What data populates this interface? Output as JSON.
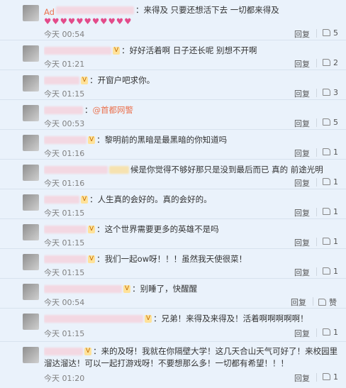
{
  "comments": [
    {
      "name": "Ad",
      "badge": "",
      "text": "：来得及 只要还想活下去 一切都来得及",
      "hearts": "♥♥♥♥♥♥♥♥♥♥♥",
      "time": "今天 00:54",
      "reply": "回复",
      "likes": "5"
    },
    {
      "name": "",
      "badge": "V",
      "text": "：好好活着啊 日子还长呢 别想不开啊",
      "time": "今天 01:21",
      "reply": "回复",
      "likes": "2"
    },
    {
      "name": "",
      "badge": "V",
      "text": "：开窗户吧求你。",
      "time": "今天 01:15",
      "reply": "回复",
      "likes": "3"
    },
    {
      "name": "",
      "badge": "",
      "text": "：",
      "mention": "@首都网警",
      "time": "今天 00:53",
      "reply": "回复",
      "likes": "5"
    },
    {
      "name": "",
      "badge": "V",
      "text": "：黎明前的黑暗是最黑暗的你知道吗",
      "time": "今天 01:16",
      "reply": "回复",
      "likes": "1"
    },
    {
      "name": "",
      "badge": "",
      "text": "候是你觉得不够好那只是没到最后而已 真的 前途光明",
      "time": "今天 01:16",
      "reply": "回复",
      "likes": "1"
    },
    {
      "name": "",
      "badge": "V",
      "text": "：人生真的会好的。真的会好的。",
      "time": "今天 01:15",
      "reply": "回复",
      "likes": "1"
    },
    {
      "name": "",
      "badge": "V",
      "text": "：这个世界需要更多的英雄不是吗",
      "time": "今天 01:15",
      "reply": "回复",
      "likes": "1"
    },
    {
      "name": "",
      "badge": "V",
      "text": "：我们一起ow呀！！！虽然我天使很菜！",
      "time": "今天 01:15",
      "reply": "回复",
      "likes": "1"
    },
    {
      "name": "",
      "badge": "V",
      "text": "：别睡了，快醒醒",
      "time": "今天 00:54",
      "reply": "回复",
      "likes": "赞"
    },
    {
      "name": "",
      "badge": "V",
      "text": "：兄弟！来得及来得及！活着啊啊啊啊啊！",
      "time": "今天 01:15",
      "reply": "回复",
      "likes": "1"
    },
    {
      "name": "",
      "badge": "V",
      "text": "：来的及呀！我就在你隔壁大学！这几天合山天气可好了！来校园里溜达溜达！可以一起打游戏呀！不要想那么多！一切都有希望！！！",
      "time": "今天 01:20",
      "reply": "回复",
      "likes": "1"
    }
  ]
}
